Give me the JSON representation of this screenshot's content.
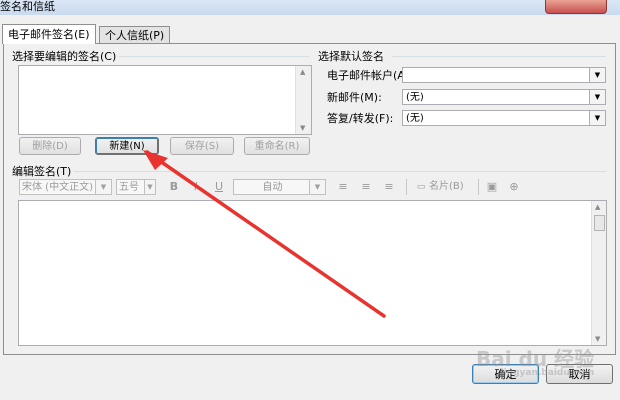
{
  "window": {
    "title": "签名和信纸"
  },
  "tabs": [
    {
      "label": "电子邮件签名(E)",
      "active": true
    },
    {
      "label": "个人信纸(P)",
      "active": false
    }
  ],
  "select_signature": {
    "label": "选择要编辑的签名(C)",
    "items": [],
    "buttons": {
      "delete": "删除(D)",
      "new": "新建(N)",
      "save": "保存(S)",
      "rename": "重命名(R)"
    }
  },
  "default_signature": {
    "label": "选择默认签名",
    "account_label": "电子邮件帐户(A):",
    "new_messages_label": "新邮件(M):",
    "new_messages_value": "(无)",
    "replies_label": "答复/转发(F):",
    "replies_value": "(无)"
  },
  "editor": {
    "label": "编辑签名(T)",
    "font_value": "宋体 (中文正文)",
    "size_value": "五号",
    "bold": "B",
    "italic": "I",
    "underline": "U",
    "color_value": "自动",
    "business_card": "名片(B)"
  },
  "footer": {
    "ok": "确定",
    "cancel": "取消"
  },
  "watermark": {
    "text": "Bai du 经验",
    "sub": "jingyan.baidu.com"
  },
  "colors": {
    "annotation_arrow": "#e8332f",
    "panel_border": "#8e8f8f"
  }
}
